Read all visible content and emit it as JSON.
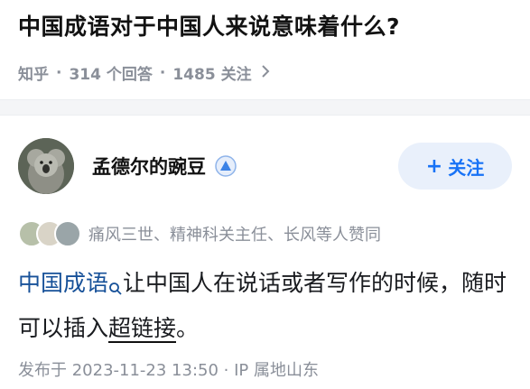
{
  "question": {
    "title": "中国成语对于中国人来说意味着什么?",
    "source": "知乎",
    "answers": "314 个回答",
    "followers": "1485 关注",
    "chevron_icon": "chevron-right-icon"
  },
  "answer": {
    "author": "孟德尔的豌豆",
    "badge_icon": "creator-badge-icon",
    "follow_label": "关注",
    "follow_plus": "+",
    "endorsement": "痛风三世、精神科关主任、长风等人赞同",
    "content": {
      "keyword": "中国成语",
      "text1": "让中国人在说话或者写作的时候，随时可以插入",
      "highlight": "超链接",
      "text2": "。"
    },
    "publish_info": "发布于 2023-11-23 13:50 · IP 属地山东"
  },
  "colors": {
    "accent": "#1772f6",
    "link": "#175199",
    "muted": "#8a8f99"
  }
}
